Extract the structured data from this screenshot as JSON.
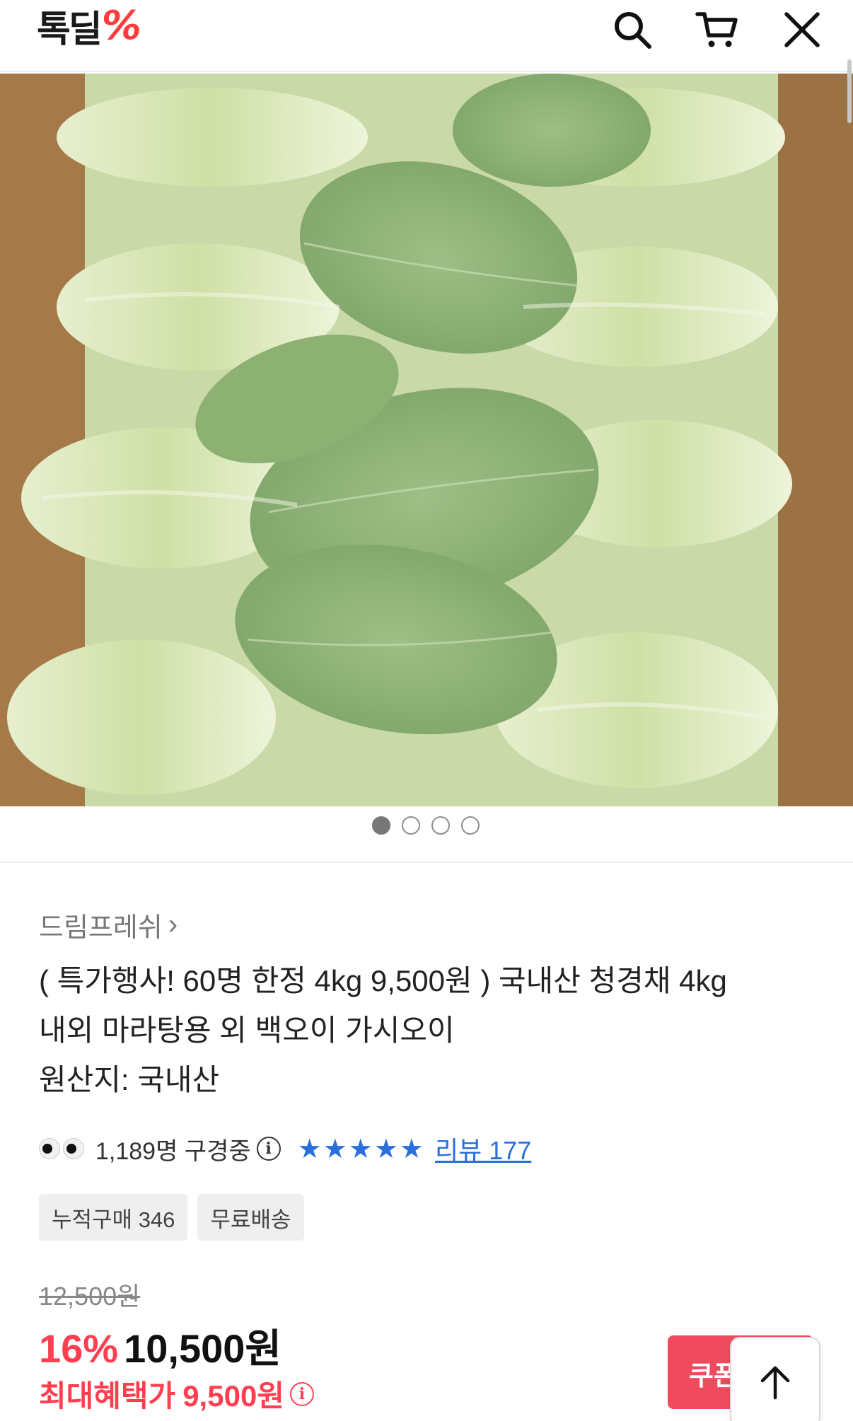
{
  "header": {
    "logo_text": "톡딜",
    "logo_mark": "%",
    "icons": [
      "search-icon",
      "cart-icon",
      "close-icon"
    ]
  },
  "gallery": {
    "dot_count": 4,
    "active_index": 0
  },
  "product": {
    "seller": "드림프레쉬",
    "title_lines": [
      "( 특가행사! 60명 한정 4kg 9,500원 ) 국내산 청경채 4kg",
      "내외 마라탕용 외 백오이 가시오이",
      "원산지: 국내산"
    ],
    "viewers": "1,189명 구경중",
    "stars": "★★★★★",
    "review_link": "리뷰 177",
    "badges": [
      "누적구매 346",
      "무료배송"
    ],
    "original_price": "12,500원",
    "discount": "16%",
    "price": "10,500원",
    "max_benefit_label": "최대혜택가",
    "max_benefit_price": "9,500원"
  },
  "actions": {
    "coupon_label": "쿠폰",
    "info_glyph": "i"
  },
  "colors": {
    "accent_red": "#ff3e50",
    "link_blue": "#2a6fdb",
    "coupon_bg": "#f04a5e"
  }
}
